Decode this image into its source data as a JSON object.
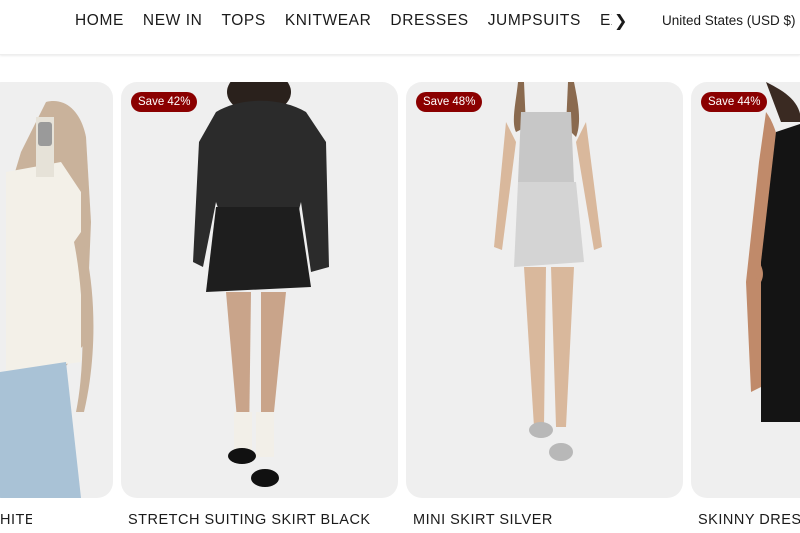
{
  "nav": {
    "items": [
      "HOME",
      "NEW IN",
      "TOPS",
      "KNITWEAR",
      "DRESSES",
      "JUMPSUITS",
      "EX"
    ],
    "region": "United States (USD $)"
  },
  "icons": {
    "next": "chevron-right-icon"
  },
  "colors": {
    "badge_bg": "#8b0000",
    "card_bg": "#efefef"
  },
  "products": [
    {
      "title": "HITE"
    },
    {
      "badge": "Save 42%",
      "title": "STRETCH SUITING SKIRT BLACK"
    },
    {
      "badge": "Save 48%",
      "title": "MINI SKIRT SILVER"
    },
    {
      "badge": "Save 44%",
      "title": "SKINNY DRESS"
    }
  ]
}
